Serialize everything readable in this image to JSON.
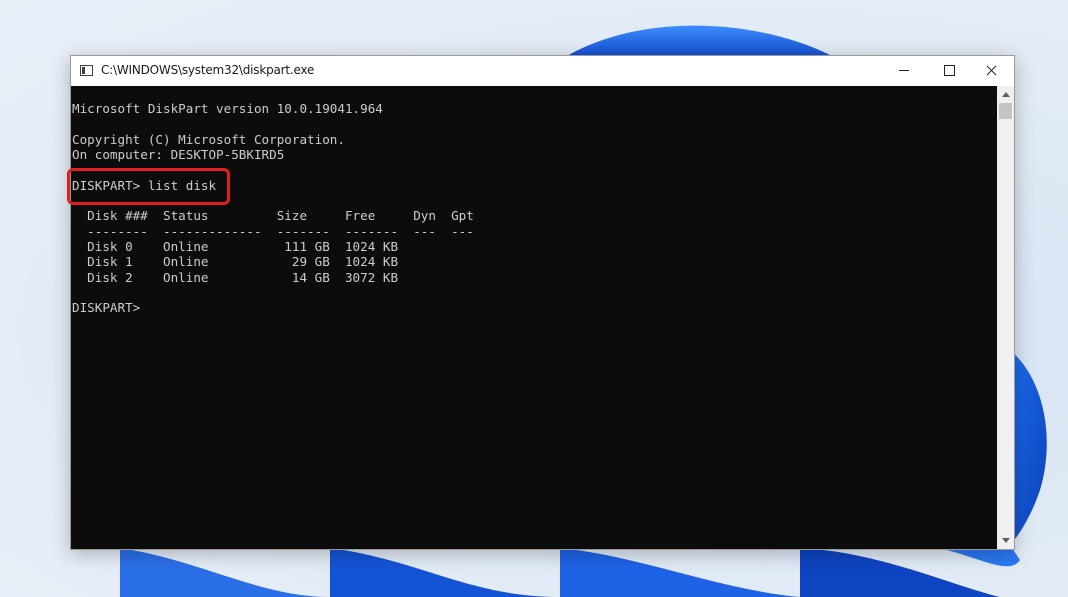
{
  "window": {
    "title": "C:\\WINDOWS\\system32\\diskpart.exe",
    "controls": {
      "minimize": "minimize",
      "maximize": "maximize",
      "close": "close"
    }
  },
  "console": {
    "lines": [
      "Microsoft DiskPart version 10.0.19041.964",
      "",
      "Copyright (C) Microsoft Corporation.",
      "On computer: DESKTOP-5BKIRD5",
      "",
      "DISKPART> list disk",
      "",
      "  Disk ###  Status         Size     Free     Dyn  Gpt",
      "  --------  -------------  -------  -------  ---  ---",
      "  Disk 0    Online          111 GB  1024 KB",
      "  Disk 1    Online           29 GB  1024 KB",
      "  Disk 2    Online           14 GB  3072 KB",
      "",
      "DISKPART>"
    ]
  },
  "colors": {
    "console_bg": "#0c0c0c",
    "console_text": "#cccccc",
    "highlight": "#e02020"
  }
}
